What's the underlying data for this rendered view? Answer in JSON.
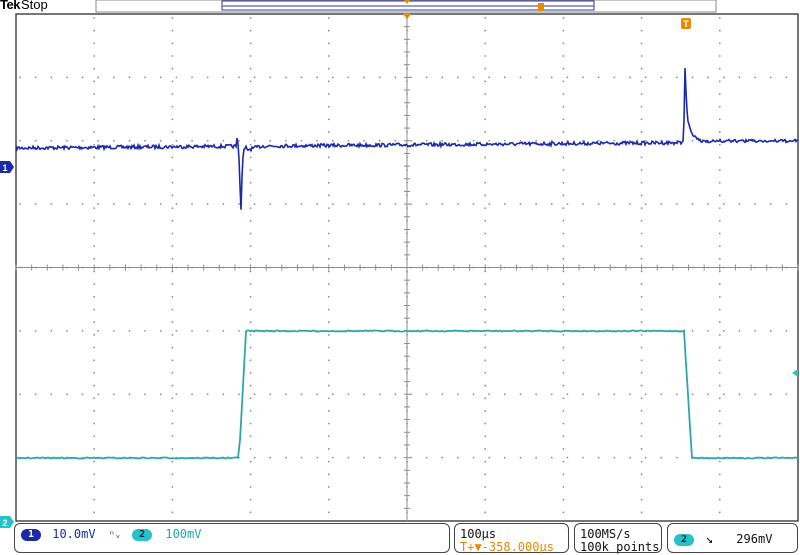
{
  "brand": {
    "logo": "Tek",
    "state": "Stop"
  },
  "colors": {
    "ch1": "#1a2aa8",
    "ch2": "#2ea6a8",
    "grid": "#8c8c8c",
    "trigger": "#e68a00",
    "frame": "#3c3c3c"
  },
  "markers": {
    "ch1": "1",
    "ch2": "2",
    "trigger": "T"
  },
  "status": {
    "ch1_scale": "10.0mV",
    "ch1_coupling_symbol": "ᵗ",
    "ch2_scale": "100mV",
    "timebase": "100µs",
    "trigger_offset": "T+▼-358.000µs",
    "sample_rate": "100MS/s",
    "record_length": "100k points",
    "trigger_source": "2",
    "trigger_slope_symbol": "↙",
    "trigger_level": "296mV"
  }
}
